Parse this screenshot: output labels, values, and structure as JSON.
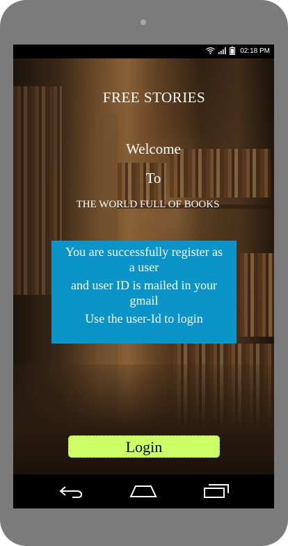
{
  "status_bar": {
    "time": "02:18 PM",
    "icons": [
      "wifi-icon",
      "signal-icon",
      "battery-icon"
    ]
  },
  "header": {
    "title": "FREE STORIES"
  },
  "welcome": {
    "line1": "Welcome",
    "line2": "To",
    "line3": "THE WORLD FULL OF BOOKS"
  },
  "message": {
    "lines": [
      "You are successfully register as",
      "a user",
      "and user ID is mailed in your",
      "gmail",
      "Use the user-Id to login"
    ]
  },
  "login_button": {
    "label": "Login"
  },
  "nav_bar": {
    "items": [
      "back-icon",
      "home-icon",
      "recents-icon"
    ]
  },
  "colors": {
    "message_bg": "#0a94c8",
    "login_bg": "#ccff66",
    "text": "#ffffff"
  }
}
